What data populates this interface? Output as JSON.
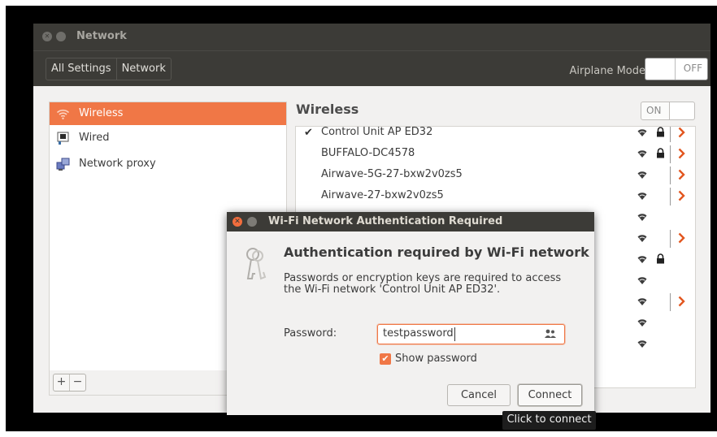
{
  "window": {
    "title": "Network",
    "breadcrumbs": [
      "All Settings",
      "Network"
    ],
    "airplane_mode_label": "Airplane Mode",
    "airplane_mode_state": "OFF"
  },
  "sidebar": {
    "items": [
      {
        "label": "Wireless",
        "icon": "wifi-icon",
        "active": true
      },
      {
        "label": "Wired",
        "icon": "wired-icon",
        "active": false
      },
      {
        "label": "Network proxy",
        "icon": "proxy-icon",
        "active": false
      }
    ],
    "add_label": "+",
    "remove_label": "−"
  },
  "wireless": {
    "title": "Wireless",
    "toggle_state": "ON",
    "networks": [
      {
        "name": "Control Unit AP ED32",
        "connected": true,
        "secured": true,
        "has_settings": true
      },
      {
        "name": "BUFFALO-DC4578",
        "connected": false,
        "secured": true,
        "has_settings": true
      },
      {
        "name": "Airwave-5G-27-bxw2v0zs5",
        "connected": false,
        "secured": false,
        "has_settings": true
      },
      {
        "name": "Airwave-27-bxw2v0zs5",
        "connected": false,
        "secured": false,
        "has_settings": true
      },
      {
        "name": "",
        "connected": false,
        "secured": false,
        "has_settings": false
      },
      {
        "name": "",
        "connected": false,
        "secured": false,
        "has_settings": true
      },
      {
        "name": "",
        "connected": false,
        "secured": true,
        "has_settings": false
      },
      {
        "name": "",
        "connected": false,
        "secured": false,
        "has_settings": false
      },
      {
        "name": "",
        "connected": false,
        "secured": false,
        "has_settings": true
      },
      {
        "name": "",
        "connected": false,
        "secured": false,
        "has_settings": false
      },
      {
        "name": "",
        "connected": false,
        "secured": false,
        "has_settings": false
      }
    ]
  },
  "dialog": {
    "title": "Wi-Fi Network Authentication Required",
    "heading": "Authentication required by Wi-Fi network",
    "description": "Passwords or encryption keys are required to access the Wi-Fi network 'Control Unit AP ED32'.",
    "password_label": "Password:",
    "password_value": "testpassword",
    "show_password_label": "Show password",
    "show_password_checked": true,
    "cancel_label": "Cancel",
    "connect_label": "Connect"
  },
  "tooltip": {
    "text": "Click to connect"
  },
  "colors": {
    "accent": "#f07746",
    "titlebar": "#3c3b37",
    "background": "#f2f1f0"
  }
}
